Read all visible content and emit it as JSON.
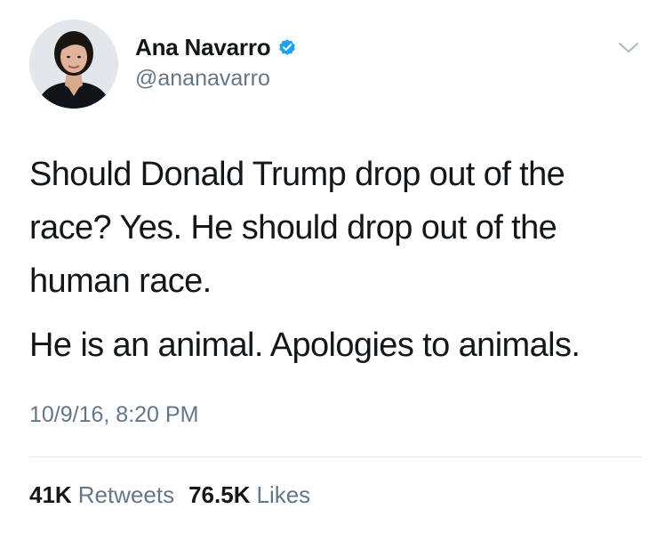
{
  "tweet": {
    "author": {
      "display_name": "Ana Navarro",
      "handle": "@ananavarro",
      "verified": true,
      "avatar_icon": "profile-photo"
    },
    "menu_icon": "chevron-down-icon",
    "text": {
      "paragraph_1": "Should Donald Trump drop out of the race? Yes. He should drop out of the human race.",
      "paragraph_2": "He is an animal. Apologies to animals."
    },
    "timestamp": "10/9/16, 8:20 PM",
    "stats": {
      "retweets_count": "41K",
      "retweets_label": "Retweets",
      "likes_count": "76.5K",
      "likes_label": "Likes"
    }
  },
  "colors": {
    "text_primary": "#14171a",
    "text_secondary": "#657786",
    "verified_blue": "#1da1f2",
    "divider": "#e1e8ed"
  }
}
